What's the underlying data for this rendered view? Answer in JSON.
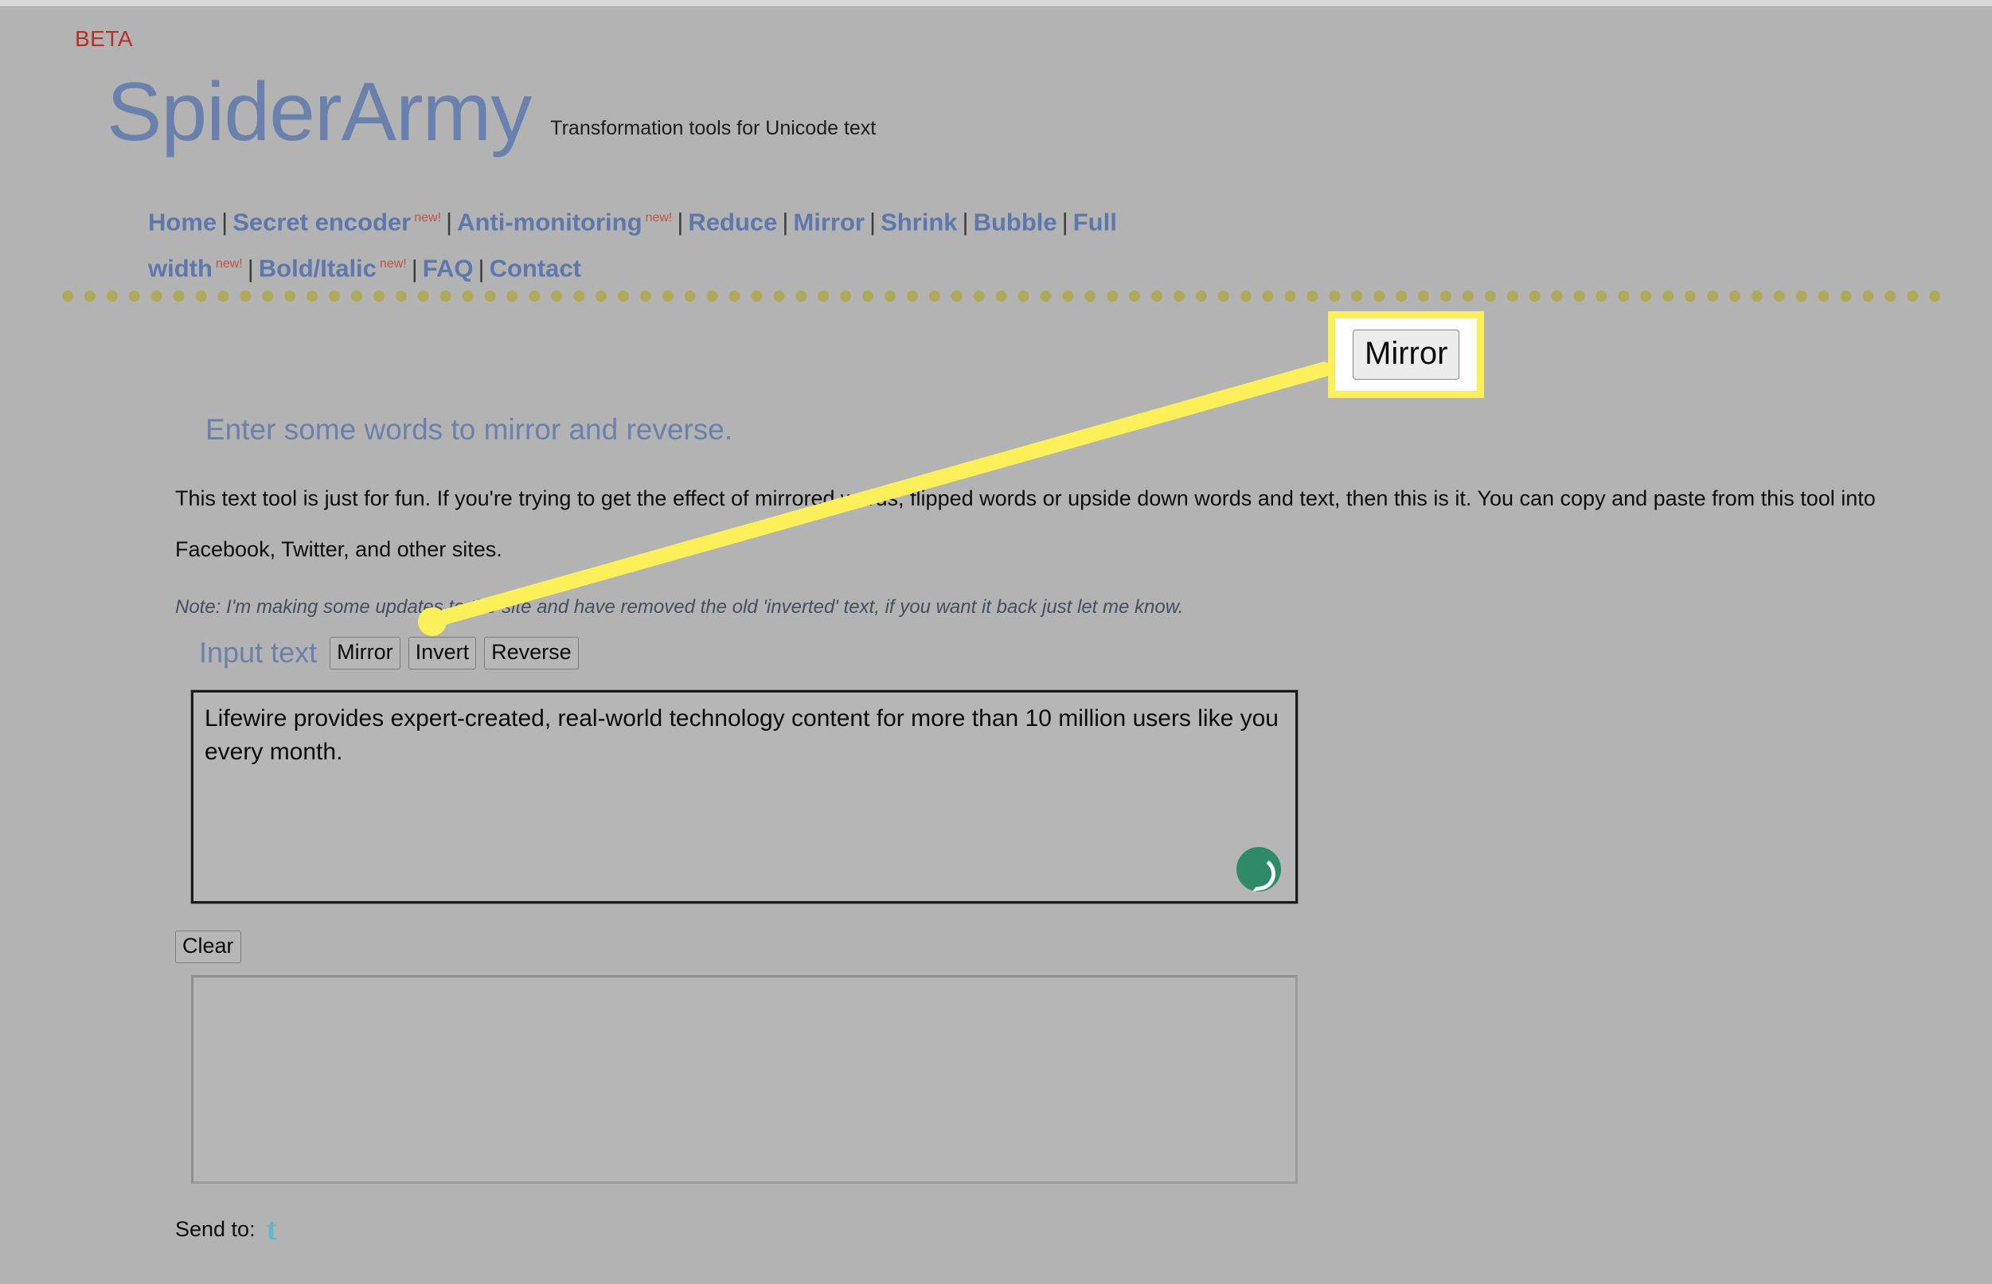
{
  "site": {
    "beta_badge": "BETA",
    "brand": "SpiderArmy",
    "tagline": "Transformation tools for Unicode text",
    "brand_color": "#6a81ad",
    "beta_color": "#b5312a",
    "page_background": "#b3b3b3"
  },
  "nav": {
    "separator": "|",
    "new_badge": "new!",
    "items": [
      {
        "label": "Home",
        "new": false
      },
      {
        "label": "Secret encoder",
        "new": true
      },
      {
        "label": "Anti-monitoring",
        "new": true
      },
      {
        "label": "Reduce",
        "new": false
      },
      {
        "label": "Mirror",
        "new": false
      },
      {
        "label": "Shrink",
        "new": false
      },
      {
        "label": "Bubble",
        "new": false
      },
      {
        "label": "Full width",
        "new": true
      },
      {
        "label": "Bold/Italic",
        "new": true
      },
      {
        "label": "FAQ",
        "new": false
      },
      {
        "label": "Contact",
        "new": false
      }
    ]
  },
  "main": {
    "heading": "Enter some words to mirror and reverse.",
    "paragraph": "This text tool is just for fun. If you're trying to get the effect of mirrored words, flipped words or upside down words and text, then this is it. You can copy and paste from this tool into Facebook, Twitter, and other sites.",
    "note": "Note: I'm making some updates to the site and have removed the old 'inverted' text, if you want it back just let me know.",
    "input_label": "Input text",
    "buttons": {
      "mirror": "Mirror",
      "invert": "Invert",
      "reverse": "Reverse",
      "clear": "Clear"
    },
    "input_textarea": {
      "value": "Lifewire provides expert-created, real-world technology content for more than 10 million users like you every month.",
      "placeholder": ""
    },
    "output_textarea": {
      "value": "",
      "placeholder": ""
    },
    "grammar_badge": "grammarly-icon",
    "send_to_label": "Send to:",
    "send_to_icon": "twitter-icon"
  },
  "annotation": {
    "callout_label": "Mirror",
    "highlight_color": "#fbf05a",
    "arrow_color": "#fbf05a"
  }
}
